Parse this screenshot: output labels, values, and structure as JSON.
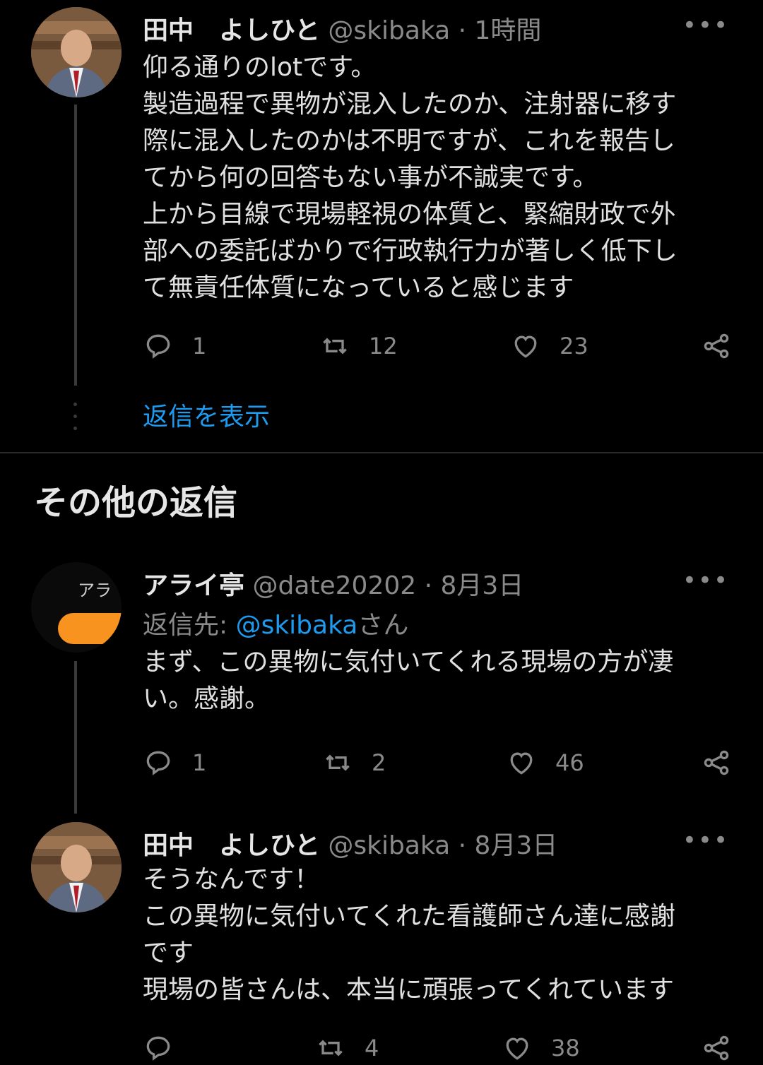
{
  "tweet1": {
    "name": "田中　よしひと",
    "handle": "@skibaka",
    "sep": "·",
    "time": "1時間",
    "more": "•••",
    "lines": [
      "仰る通りのlotです。",
      "製造過程で異物が混入したのか、注射器に移す",
      "際に混入したのかは不明ですが、これを報告し",
      "てから何の回答もない事が不誠実です。",
      "上から目線で現場軽視の体質と、緊縮財政で外",
      "部への委託ばかりで行政執行力が著しく低下し",
      "て無責任体質になっていると感じます"
    ],
    "replies": "1",
    "retweets": "12",
    "likes": "23",
    "show_replies": "返信を表示"
  },
  "section": {
    "title": "その他の返信"
  },
  "tweet2": {
    "name": "アライ亭",
    "handle": "@date20202",
    "sep": "·",
    "time": "8月3日",
    "more": "•••",
    "avatar_text": "アラ",
    "replyto_prefix": "返信先: ",
    "replyto_handle": "@skibaka",
    "replyto_suffix": "さん",
    "lines": [
      "まず、この異物に気付いてくれる現場の方が凄",
      "い。感謝。"
    ],
    "replies": "1",
    "retweets": "2",
    "likes": "46"
  },
  "tweet3": {
    "name": "田中　よしひと",
    "handle": "@skibaka",
    "sep": "·",
    "time": "8月3日",
    "more": "•••",
    "lines": [
      "そうなんです！",
      "この異物に気付いてくれた看護師さん達に感謝",
      "です",
      "現場の皆さんは、本当に頑張ってくれています"
    ],
    "replies": "",
    "retweets": "4",
    "likes": "38"
  }
}
